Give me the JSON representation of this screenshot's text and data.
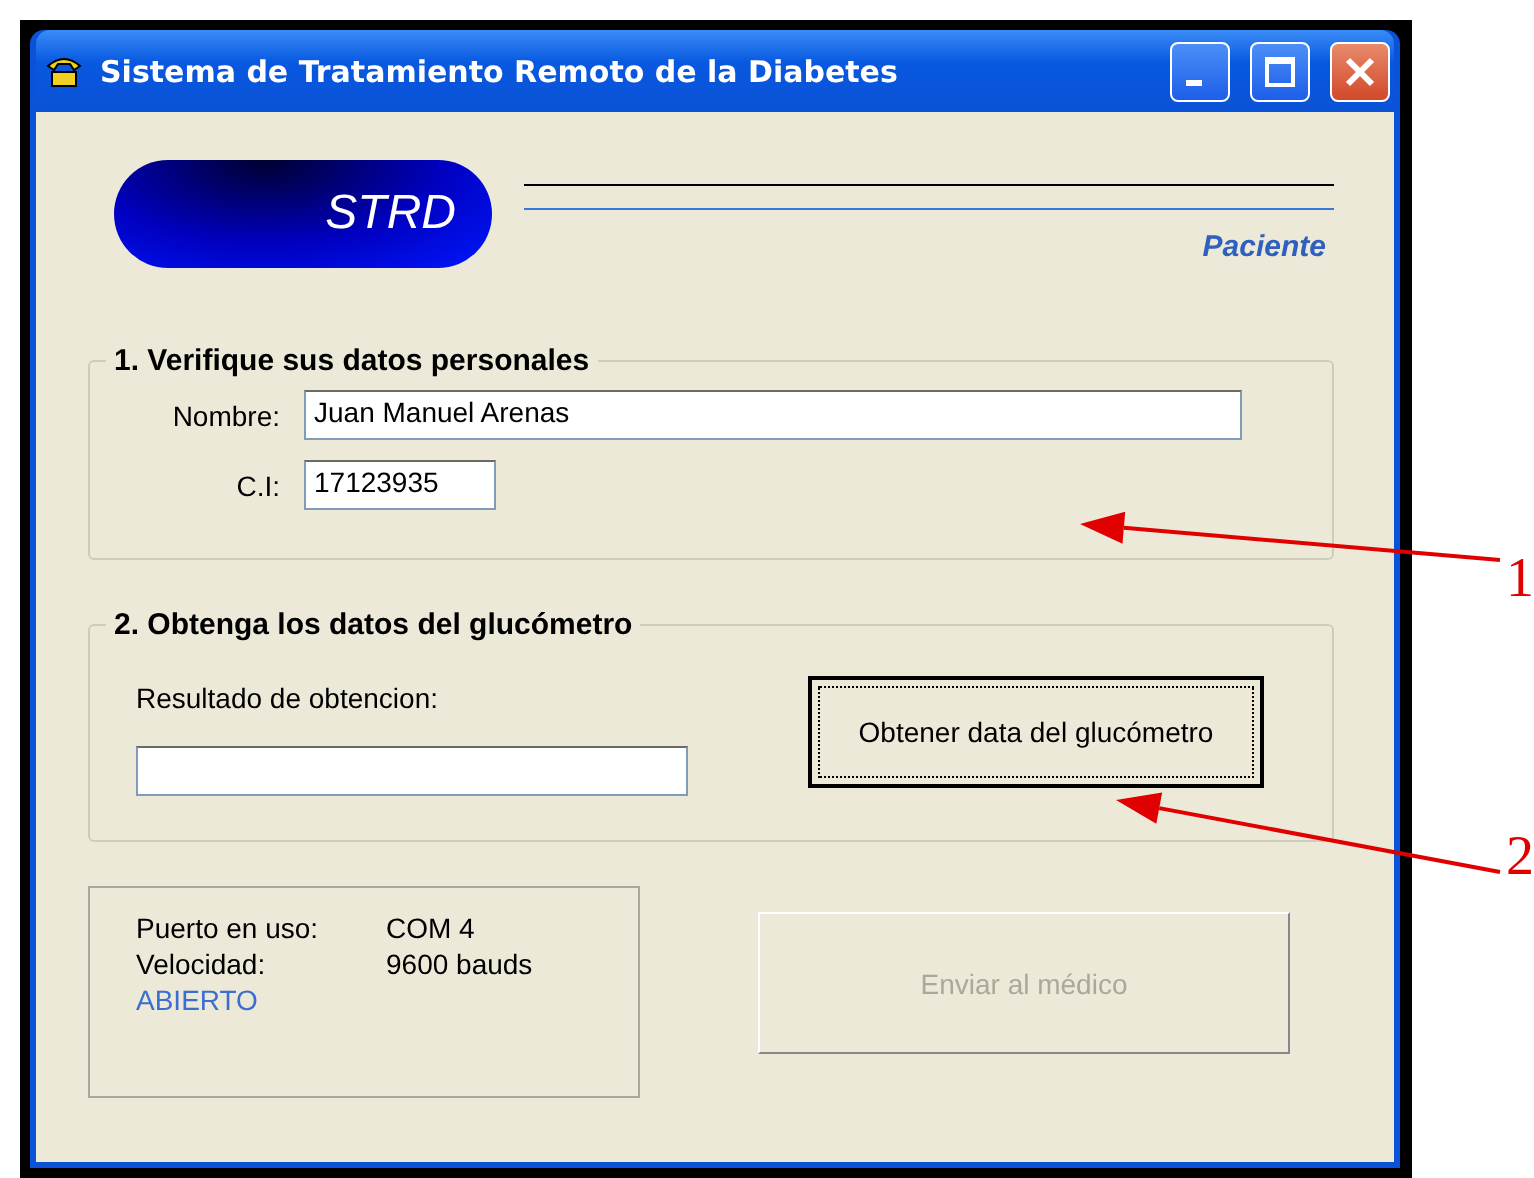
{
  "window": {
    "title": "Sistema de Tratamiento Remoto de la Diabetes"
  },
  "header": {
    "logo": "STRD",
    "role": "Paciente"
  },
  "personal": {
    "legend": "1. Verifique sus datos personales",
    "fields": [
      {
        "label": "Nombre:",
        "value": "Juan Manuel Arenas"
      },
      {
        "label": "C.I:",
        "value": "17123935"
      }
    ]
  },
  "glucometer": {
    "legend": "2. Obtenga los datos del glucómetro",
    "result_label": "Resultado de obtencion:",
    "button": {
      "label": "Obtener data del glucómetro",
      "focused": true
    }
  },
  "port": {
    "rows": [
      {
        "label": "Puerto en uso:",
        "value": "COM 4"
      },
      {
        "label": "Velocidad:",
        "value": "9600 bauds"
      }
    ],
    "status": "ABIERTO"
  },
  "send_button": {
    "label": "Enviar al médico",
    "disabled": true
  },
  "annotations": [
    {
      "label": "1"
    },
    {
      "label": "2"
    }
  ]
}
